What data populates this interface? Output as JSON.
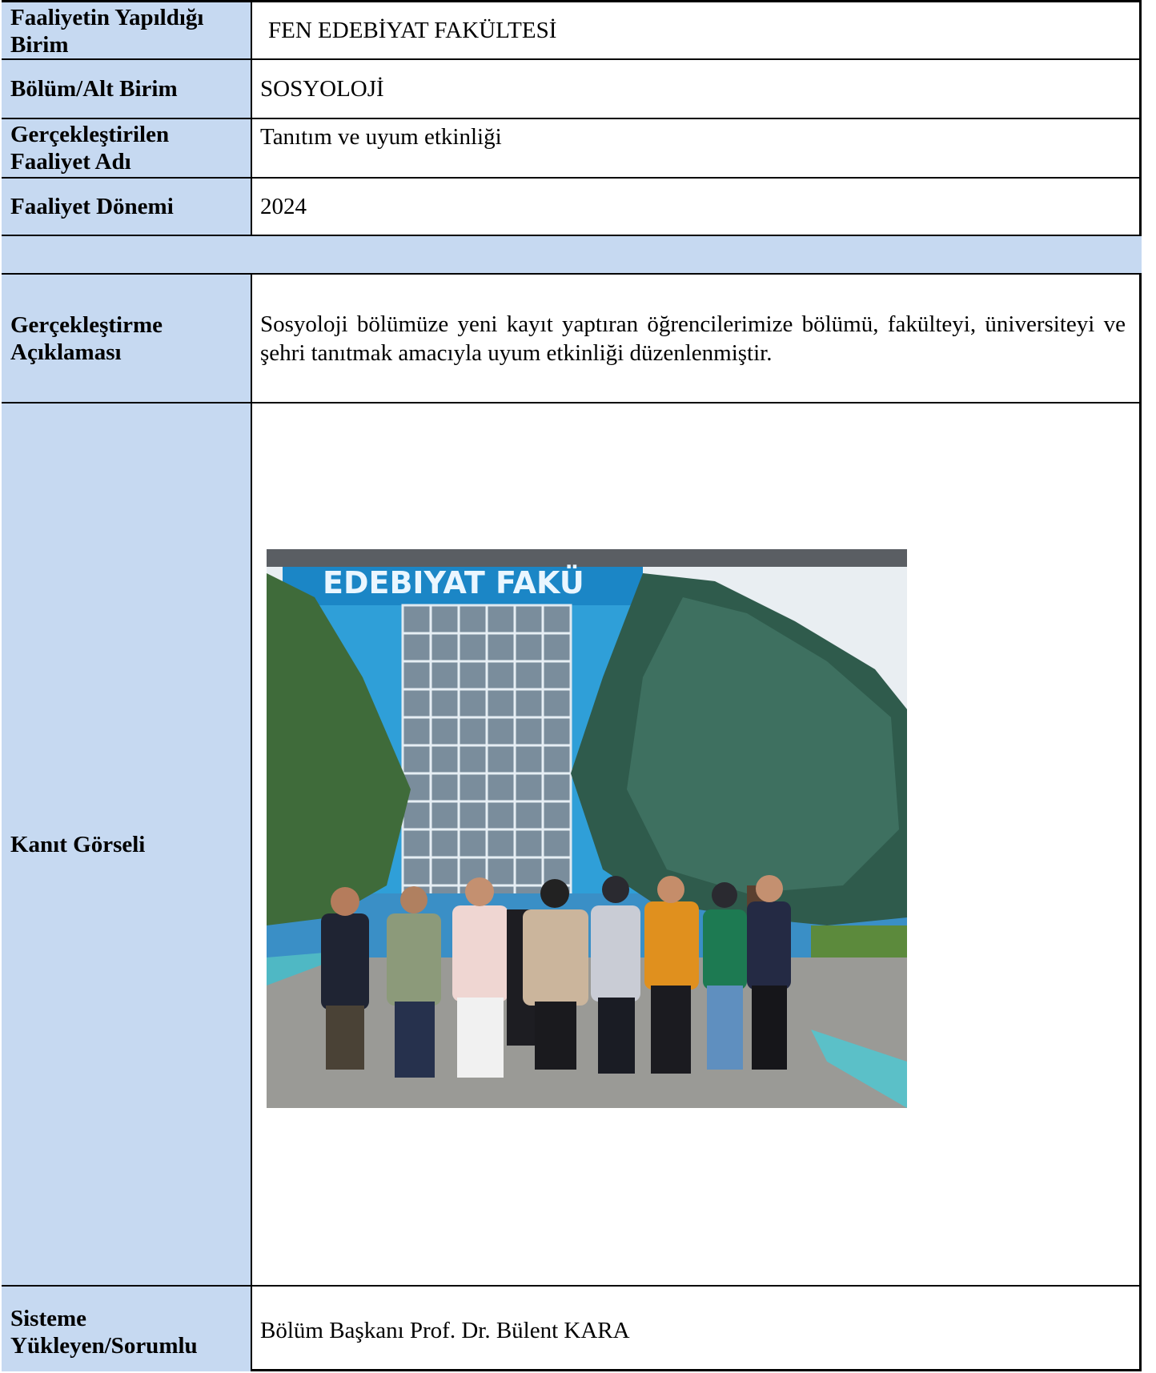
{
  "rows": {
    "birim": {
      "label": "Faaliyetin Yapıldığı Birim",
      "value": "FEN EDEBİYAT FAKÜLTESİ"
    },
    "bolum": {
      "label": "Bölüm/Alt Birim",
      "value": "SOSYOLOJİ"
    },
    "faaliyet_adi": {
      "label": "Gerçekleştirilen Faaliyet Adı",
      "value": "Tanıtım ve uyum etkinliği"
    },
    "donem": {
      "label": "Faaliyet Dönemi",
      "value": "2024"
    },
    "aciklama": {
      "label": "Gerçekleştirme Açıklaması",
      "value": "Sosyoloji bölümüze yeni kayıt yaptıran öğrencilerimize bölümü, fakülteyi, üniversiteyi ve şehri tanıtmak amacıyla uyum etkinliği düzenlenmiştir."
    },
    "gorsel": {
      "label": "Kanıt Görseli",
      "sign_text": "EDEBIYAT FAKÜ"
    },
    "sorumlu": {
      "label": "Sisteme Yükleyen/Sorumlu",
      "value": "Bölüm Başkanı Prof. Dr. Bülent KARA"
    }
  },
  "colors": {
    "label_bg": "#c6d9f1",
    "border": "#000000"
  }
}
